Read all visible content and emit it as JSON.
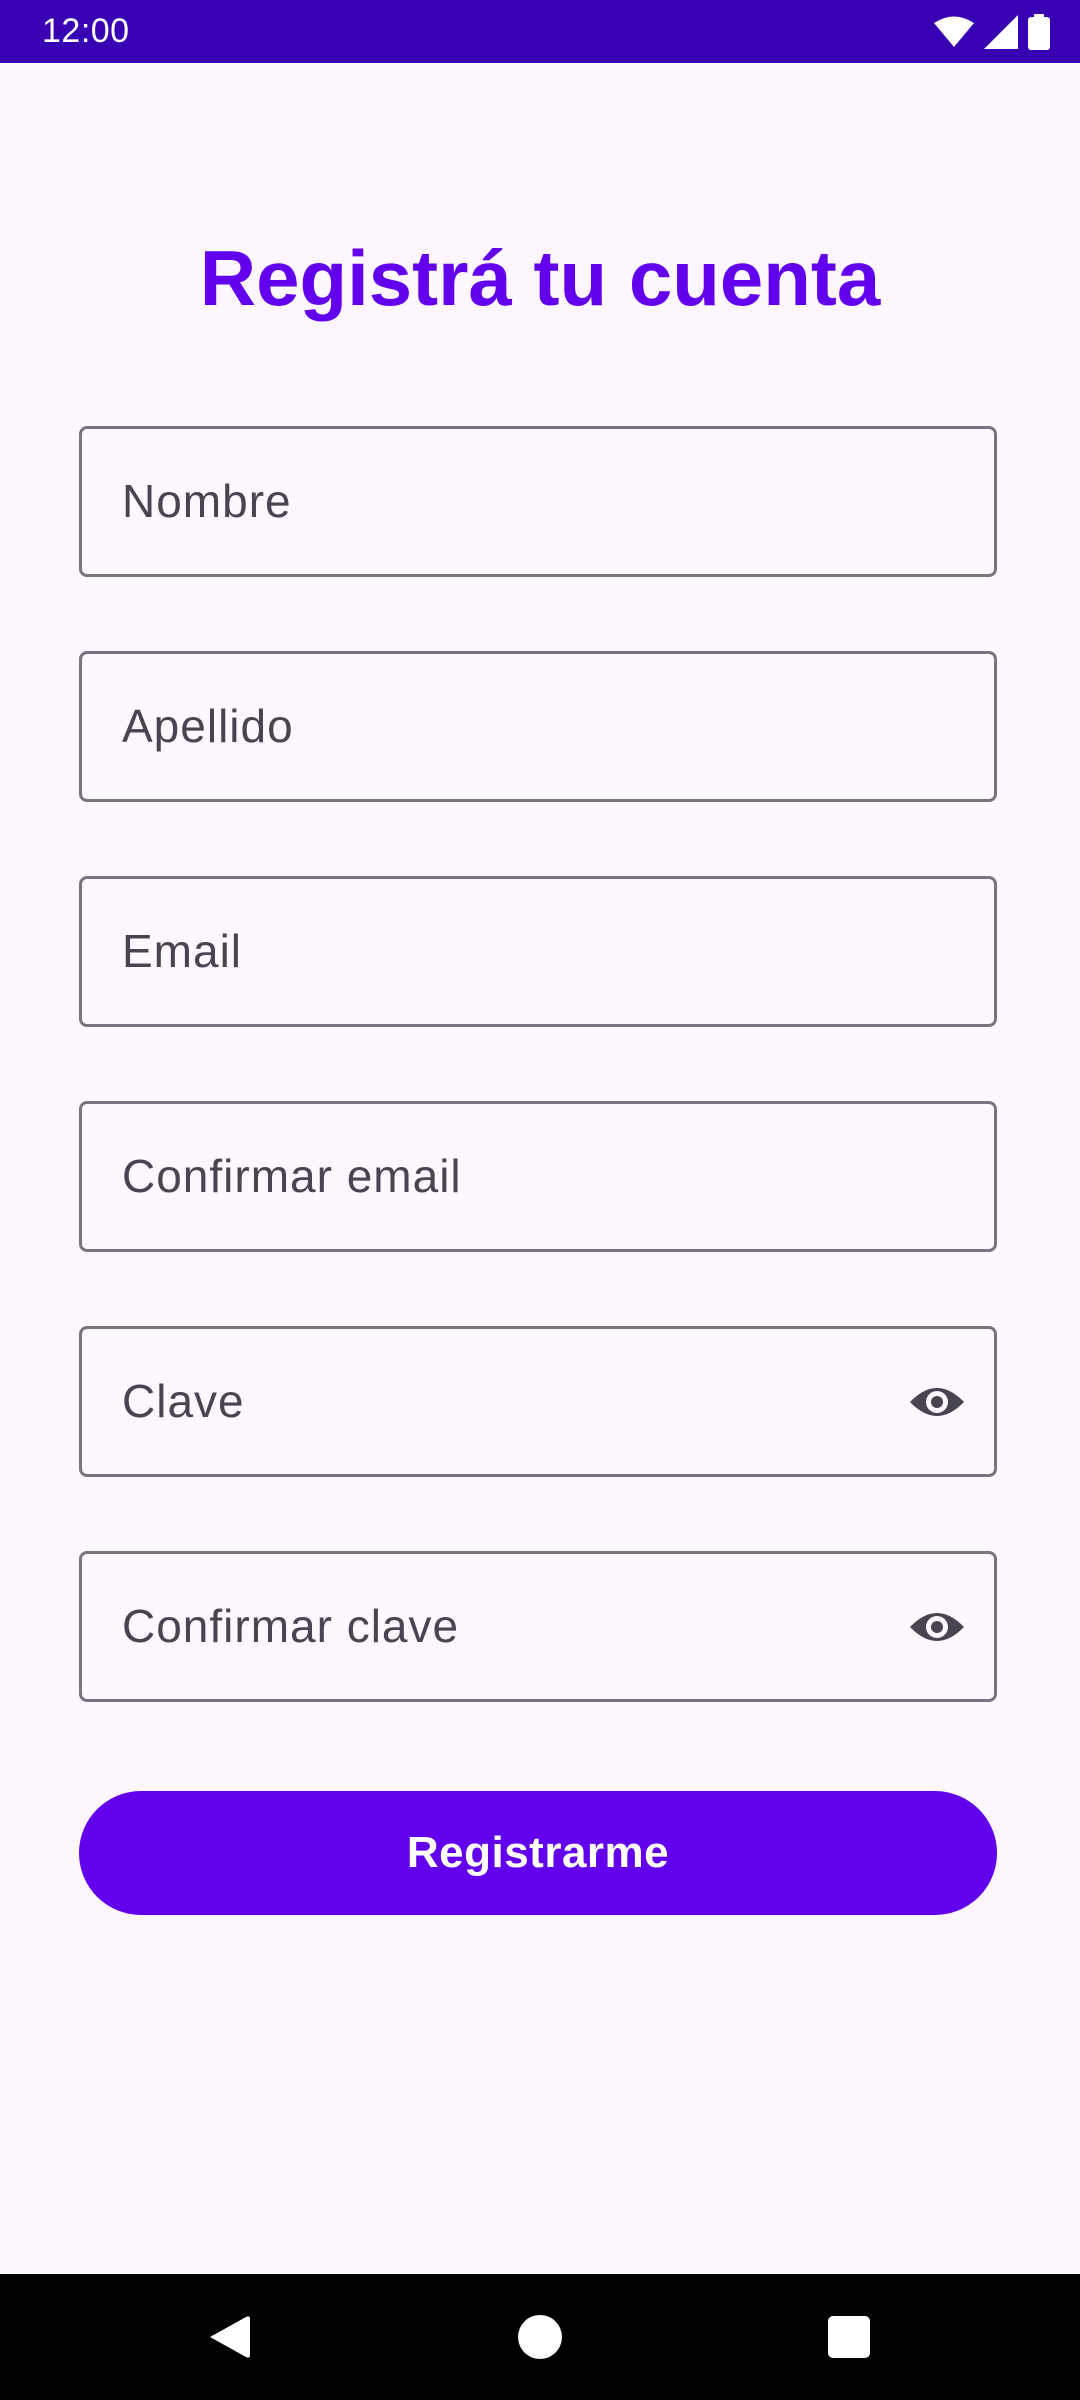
{
  "status_bar": {
    "time": "12:00",
    "icons": [
      "wifi-icon",
      "signal-icon",
      "battery-icon"
    ]
  },
  "page": {
    "title": "Registrá tu cuenta"
  },
  "form": {
    "fields": [
      {
        "label": "Nombre",
        "value": ""
      },
      {
        "label": "Apellido",
        "value": ""
      },
      {
        "label": "Email",
        "value": ""
      },
      {
        "label": "Confirmar email",
        "value": ""
      },
      {
        "label": "Clave",
        "value": "",
        "trailing_icon": "eye-icon"
      },
      {
        "label": "Confirmar clave",
        "value": "",
        "trailing_icon": "eye-icon"
      }
    ],
    "submit_label": "Registrarme"
  },
  "nav_bar": {
    "buttons": [
      "back-icon",
      "home-icon",
      "recents-icon"
    ]
  },
  "colors": {
    "accent": "#6200EE",
    "status_bar": "#3700B3",
    "background": "#FEF7FF",
    "outline": "#79747E",
    "label_text": "#49454F"
  }
}
